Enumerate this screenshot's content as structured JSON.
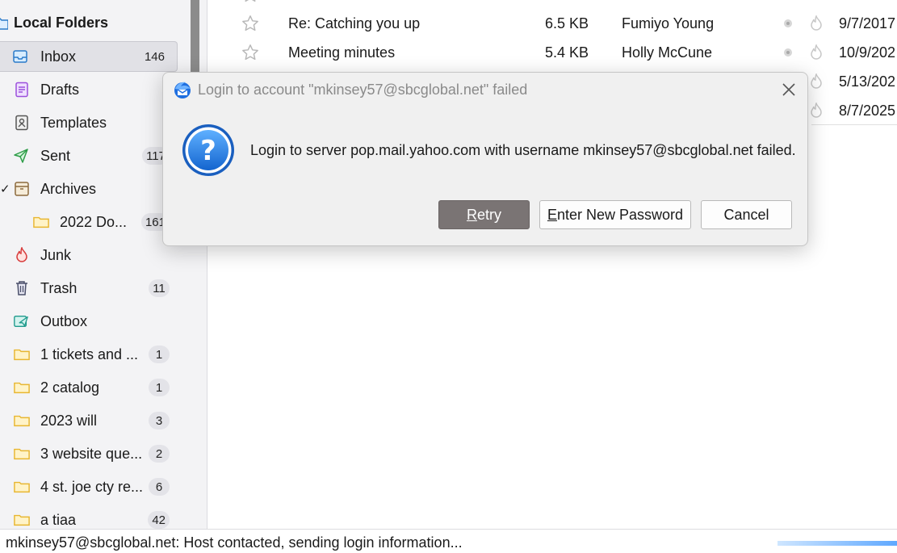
{
  "sidebar": {
    "section_title": "Local Folders",
    "folders": [
      {
        "label": "Inbox",
        "count": "146",
        "icon": "inbox-icon"
      },
      {
        "label": "Drafts",
        "count": "",
        "icon": "drafts-icon"
      },
      {
        "label": "Templates",
        "count": "",
        "icon": "templates-icon"
      },
      {
        "label": "Sent",
        "count": "117",
        "icon": "sent-icon"
      },
      {
        "label": "Archives",
        "count": "",
        "icon": "archives-icon"
      },
      {
        "label": "2022 Do...",
        "count": "161",
        "icon": "folder-icon"
      },
      {
        "label": "Junk",
        "count": "",
        "icon": "junk-icon"
      },
      {
        "label": "Trash",
        "count": "11",
        "icon": "trash-icon"
      },
      {
        "label": "Outbox",
        "count": "",
        "icon": "outbox-icon"
      },
      {
        "label": "1 tickets and ...",
        "count": "1",
        "icon": "folder-icon"
      },
      {
        "label": "2 catalog",
        "count": "1",
        "icon": "folder-icon"
      },
      {
        "label": "2023 will",
        "count": "3",
        "icon": "folder-icon"
      },
      {
        "label": "3 website que...",
        "count": "2",
        "icon": "folder-icon"
      },
      {
        "label": "4 st. joe cty re...",
        "count": "6",
        "icon": "folder-icon"
      },
      {
        "label": "a tiaa",
        "count": "42",
        "icon": "folder-icon"
      }
    ]
  },
  "messages": [
    {
      "subject": "Re: Catching you up",
      "size": "6.5 KB",
      "from": "Fumiyo Young",
      "date": "9/7/2017"
    },
    {
      "subject": "Meeting minutes",
      "size": "5.4 KB",
      "from": "Holly McCune",
      "date": "10/9/202"
    },
    {
      "subject": "",
      "size": "",
      "from": "",
      "date": "5/13/202"
    },
    {
      "subject": "",
      "size": "",
      "from": "",
      "date": "8/7/2025"
    }
  ],
  "dialog": {
    "title": "Login to account \"mkinsey57@sbcglobal.net\" failed",
    "message": "Login to server pop.mail.yahoo.com with username mkinsey57@sbcglobal.net failed.",
    "buttons": {
      "retry": {
        "first": "R",
        "rest": "etry"
      },
      "enter_new_password": {
        "first": "E",
        "rest": "nter New Password"
      },
      "cancel": "Cancel"
    }
  },
  "statusbar": {
    "text": "mkinsey57@sbcglobal.net: Host contacted, sending login information..."
  },
  "colors": {
    "accent": "#1a73e8",
    "primary_button": "#7a7474",
    "folder_yellow": "#e8b630"
  }
}
